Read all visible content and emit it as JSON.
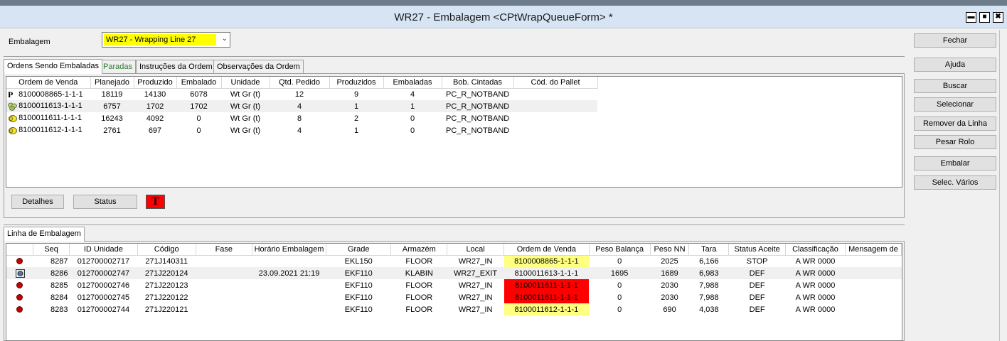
{
  "window": {
    "title": "WR27 - Embalagem <CPtWrapQueueForm> *",
    "min": "▬",
    "max": "■",
    "close": "✖"
  },
  "embalagem": {
    "label": "Embalagem",
    "value": "WR27 - Wrapping Line 27"
  },
  "tabs": [
    "Ordens Sendo Embaladas",
    "Paradas",
    "Instruções da Ordem",
    "Observações da Ordem"
  ],
  "orders": {
    "headers": [
      "Ordem de Venda",
      "Planejado",
      "Produzido",
      "Embalado",
      "Unidade",
      "Qtd. Pedido",
      "Produzidos",
      "Embaladas",
      "Bob. Cintadas",
      "Cód. do Pallet"
    ],
    "rows": [
      {
        "icon": "p-icon",
        "cells": [
          "8100008865-1-1-1",
          "18119",
          "14130",
          "6078",
          "Wt Gr (t)",
          "12",
          "9",
          "4",
          "PC_R_NOTBAND",
          ""
        ]
      },
      {
        "icon": "rolls-green-icon",
        "cells": [
          "8100011613-1-1-1",
          "6757",
          "1702",
          "1702",
          "Wt Gr (t)",
          "4",
          "1",
          "1",
          "PC_R_NOTBAND",
          ""
        ]
      },
      {
        "icon": "roll-yellow-icon",
        "cells": [
          "8100011611-1-1-1",
          "16243",
          "4092",
          "0",
          "Wt Gr (t)",
          "8",
          "2",
          "0",
          "PC_R_NOTBAND",
          ""
        ]
      },
      {
        "icon": "roll-yellow-icon",
        "cells": [
          "8100011612-1-1-1",
          "2761",
          "697",
          "0",
          "Wt Gr (t)",
          "4",
          "1",
          "0",
          "PC_R_NOTBAND",
          ""
        ]
      }
    ]
  },
  "buttons": {
    "detalhes": "Detalhes",
    "status": "Status",
    "t": "T"
  },
  "linha_tab": "Linha de Embalagem",
  "linha": {
    "headers": [
      "",
      "Seq",
      "ID Unidade",
      "Código",
      "Fase",
      "Horário  Embalagem",
      "Grade",
      "Armazém",
      "Local",
      "Ordem de Venda",
      "Peso Balança",
      "Peso NN",
      "Tara",
      "Status Aceite",
      "Classificação",
      "Mensagem de"
    ],
    "rows": [
      {
        "icon": "red-dot-icon",
        "cells": [
          "8287",
          "012700002717",
          "271J140311",
          "",
          "",
          "EKL150",
          "FLOOR",
          "WR27_IN",
          "8100008865-1-1-1",
          "0",
          "2025",
          "6,166",
          "STOP",
          "A WR 0000",
          ""
        ],
        "ov": "yellow"
      },
      {
        "icon": "roll-box-icon",
        "cells": [
          "8286",
          "012700002747",
          "271J220124",
          "",
          "23.09.2021 21:19",
          "EKF110",
          "KLABIN",
          "WR27_EXIT",
          "8100011613-1-1-1",
          "1695",
          "1689",
          "6,983",
          "DEF",
          "A WR 0000",
          ""
        ],
        "ov": "none"
      },
      {
        "icon": "red-dot-icon",
        "cells": [
          "8285",
          "012700002746",
          "271J220123",
          "",
          "",
          "EKF110",
          "FLOOR",
          "WR27_IN",
          "8100011611-1-1-1",
          "0",
          "2030",
          "7,988",
          "DEF",
          "A WR 0000",
          ""
        ],
        "ov": "red"
      },
      {
        "icon": "red-dot-icon",
        "cells": [
          "8284",
          "012700002745",
          "271J220122",
          "",
          "",
          "EKF110",
          "FLOOR",
          "WR27_IN",
          "8100011611-1-1-1",
          "0",
          "2030",
          "7,988",
          "DEF",
          "A WR 0000",
          ""
        ],
        "ov": "red"
      },
      {
        "icon": "red-dot-icon",
        "cells": [
          "8283",
          "012700002744",
          "271J220121",
          "",
          "",
          "EKF110",
          "FLOOR",
          "WR27_IN",
          "8100011612-1-1-1",
          "0",
          "690",
          "4,038",
          "DEF",
          "A WR 0000",
          ""
        ],
        "ov": "yellow"
      }
    ]
  },
  "side_buttons": [
    "Fechar",
    "Ajuda",
    "Buscar",
    "Selecionar",
    "Remover da Linha",
    "Pesar Rolo",
    "Embalar",
    "Selec. Vários"
  ],
  "colors": {
    "highlight_yellow": "#ffff00",
    "ov_yellow": "#ffff80",
    "ov_red": "#ff0000",
    "tab_paradas": "#2a7a2a"
  }
}
